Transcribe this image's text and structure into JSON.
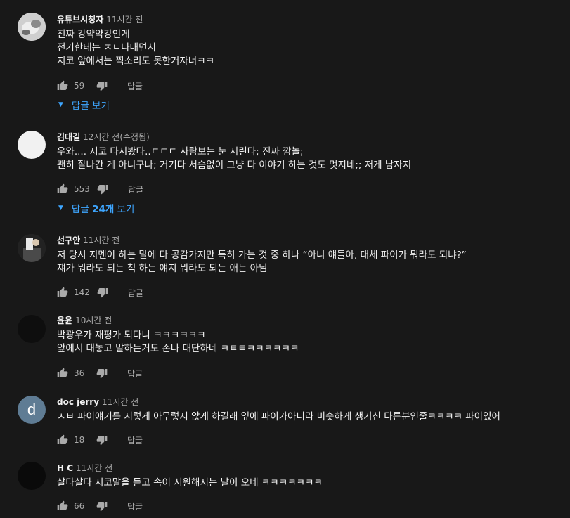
{
  "colors": {
    "background": "#181818",
    "text": "#f1f1f1",
    "secondary": "#aaaaaa",
    "link": "#3ea6ff"
  },
  "comments": [
    {
      "author": "유튜브시청자",
      "time": "11시간 전",
      "lines": [
        "진짜 강약약강인게",
        "전기한테는 ㅈㄴ나대면서",
        "지코 앞에서는 찍소리도 못한거자너ㅋㅋ"
      ],
      "likes": "59",
      "reply_label": "답글",
      "replies_toggle": "답글 보기"
    },
    {
      "author": "김대길",
      "time": "12시간 전(수정됨)",
      "lines": [
        "우와.... 지코 다시봤다..ㄷㄷㄷ   사람보는 눈 지린다;  진짜 깜놀;",
        "괜히 잘나간 게 아니구나; 거기다 서슴없이 그냥 다 이야기 하는 것도 멋지네;;  저게 남자지"
      ],
      "likes": "553",
      "reply_label": "답글",
      "replies_prefix": "답글 ",
      "replies_count": "24개",
      "replies_suffix": " 보기"
    },
    {
      "author": "선구안",
      "time": "11시간 전",
      "lines": [
        "저 당시 지멘이 하는 말에 다 공감가지만 특히 가는 것 중 하나 “아니 얘들아, 대체 파이가 뭐라도 되냐?”",
        "쟤가 뭐라도 되는 척 하는 얘지 뭐라도 되는 애는 아님"
      ],
      "likes": "142",
      "reply_label": "답글"
    },
    {
      "author": "윤윤",
      "time": "10시간 전",
      "lines": [
        "박광우가 재평가 되다니 ㅋㅋㅋㅋㅋㅋ",
        "앞에서 대놓고 말하는거도 존나 대단하네 ㅋㅌㅌㅋㅋㅋㅋㅋㅋ"
      ],
      "likes": "36",
      "reply_label": "답글"
    },
    {
      "author": "doc jerry",
      "time": "11시간 전",
      "avatar_letter": "d",
      "lines": [
        "ㅅㅂ 파이얘기를 저렇게 아무렇지 않게 하길래 옆에 파이가아니라 비슷하게 생기신 다른분인줄ㅋㅋㅋㅋ 파이였어"
      ],
      "likes": "18",
      "reply_label": "답글"
    },
    {
      "author": "H C",
      "time": "11시간 전",
      "lines": [
        "살다살다 지코말을 듣고 속이 시원해지는 날이 오네 ㅋㅋㅋㅋㅋㅋㅋ"
      ],
      "likes": "66",
      "reply_label": "답글"
    }
  ]
}
